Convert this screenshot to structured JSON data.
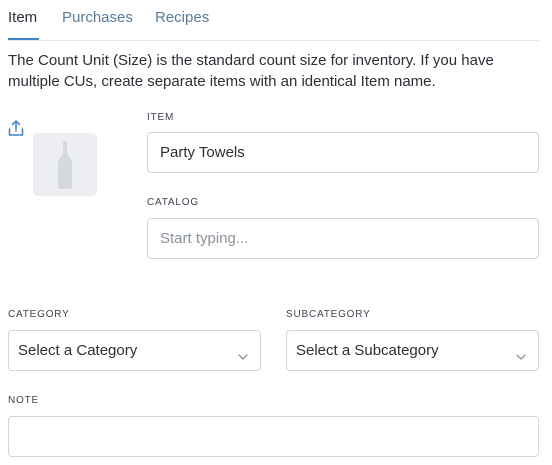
{
  "tabs": [
    {
      "label": "Item",
      "active": true
    },
    {
      "label": "Purchases",
      "active": false
    },
    {
      "label": "Recipes",
      "active": false
    }
  ],
  "intro_text": "The Count Unit (Size) is the standard count size for inventory. If you have multiple CUs, create separate items with an identical Item name.",
  "icons": {
    "upload": "upload-icon",
    "placeholder_image": "bottle-icon",
    "dropdown": "chevron-down-icon"
  },
  "form": {
    "item": {
      "label": "ITEM",
      "value": "Party Towels"
    },
    "catalog": {
      "label": "CATALOG",
      "value": "",
      "placeholder": "Start typing..."
    },
    "category": {
      "label": "CATEGORY",
      "selected": "Select a Category"
    },
    "subcategory": {
      "label": "SUBCATEGORY",
      "selected": "Select a Subcategory"
    },
    "note": {
      "label": "NOTE",
      "value": ""
    }
  },
  "colors": {
    "accent": "#3f82c6",
    "tab_inactive": "#5b7a9a",
    "border": "#cfd5dc",
    "thumb_bg": "#eceef1"
  }
}
